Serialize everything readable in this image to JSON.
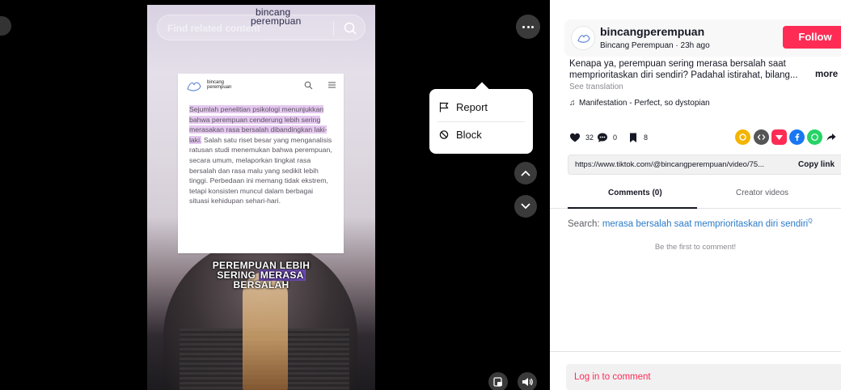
{
  "video": {
    "search_placeholder": "Find related content",
    "brand_overlay": [
      "bincang",
      "perempuan"
    ],
    "article": {
      "logo_text": [
        "bincang",
        "perempuan"
      ],
      "body_highlighted": "Sejumlah penelitian psikologi menunjukkan bahwa perempuan cenderung lebih sering merasakan rasa bersalah dibandingkan laki-laki.",
      "body_rest": " Salah satu riset besar yang menganalisis ratusan studi menemukan bahwa perempuan, secara umum, melaporkan tingkat rasa bersalah dan rasa malu yang sedikit lebih tinggi. Perbedaan ini memang tidak ekstrem, tetapi konsisten muncul dalam berbagai situasi kehidupan sehari-hari."
    },
    "caption": {
      "line1": "PEREMPUAN LEBIH",
      "line2_a": "SERING ",
      "line2_b": "MERASA",
      "line3": "BERSALAH",
      "highlight_color": "#6d49b6"
    },
    "menu": {
      "report_label": "Report",
      "block_label": "Block"
    }
  },
  "panel": {
    "username": "bincangperempuan",
    "meta": "Bincang Perempuan · 23h ago",
    "follow_label": "Follow",
    "description": "Kenapa ya, perempuan sering merasa bersalah saat memprioritaskan diri sendiri? Padahal istirahat, bilang...",
    "more_label": "more",
    "see_translation": "See translation",
    "music": "Manifestation - Perfect, so dystopian",
    "likes": "32",
    "comments": "0",
    "saves": "8",
    "link": "https://www.tiktok.com/@bincangperempuan/video/75...",
    "copy_link_label": "Copy link",
    "tab_comments": "Comments (0)",
    "tab_creator": "Creator videos",
    "search_prefix": "Search: ",
    "search_query": "merasa bersalah saat memprioritaskan diri sendiri",
    "first_comment": "Be the first to comment!",
    "login_label": "Log in to comment",
    "accent_color": "#fe2c55"
  }
}
